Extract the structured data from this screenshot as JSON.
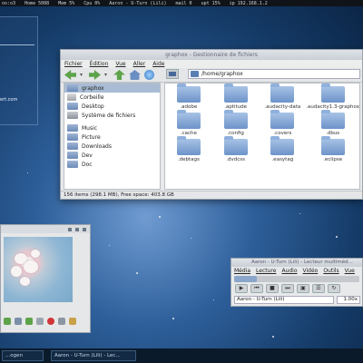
{
  "topbar": {
    "items": [
      "oo:o3",
      "Home 5088",
      "Mem 5%",
      "Cpu 0%",
      "Aaron - U-Turn (Lili)",
      "mail 0",
      "upt 15%",
      "ip 192.168.1.2"
    ]
  },
  "ghost": {
    "url": "ert.com"
  },
  "file_manager": {
    "title": "graphox - Gestionnaire de fichiers",
    "menu": [
      "Fichier",
      "Édition",
      "Vue",
      "Aller",
      "Aide"
    ],
    "path": "/home/graphox",
    "sidebar": [
      {
        "label": "graphox",
        "icon": "home-folder-icon",
        "active": true
      },
      {
        "label": "Corbeille",
        "icon": "trash-icon"
      },
      {
        "label": "Desktop",
        "icon": "folder-icon"
      },
      {
        "label": "Système de fichiers",
        "icon": "drive-icon"
      },
      {
        "label": "Music",
        "icon": "folder-icon"
      },
      {
        "label": "Picture",
        "icon": "folder-icon"
      },
      {
        "label": "Downloads",
        "icon": "folder-icon"
      },
      {
        "label": "Dev",
        "icon": "folder-icon"
      },
      {
        "label": "Doc",
        "icon": "folder-icon"
      }
    ],
    "files": [
      ".adobe",
      ".aptitude",
      ".audacity-data",
      ".audacity1.3-graphox",
      ".cache",
      ".config",
      ".covers",
      ".dbus",
      ".debtags",
      ".dvdcss",
      ".easytag",
      ".eclipse"
    ],
    "status": "156 items (298.1 MB), Free space: 403.8 GB"
  },
  "media_player": {
    "title": "Aaron - U-Turn (Lili) - Lecteur multiméd...",
    "menu": [
      "Média",
      "Lecture",
      "Audio",
      "Vidéo",
      "Outils",
      "Vue"
    ],
    "progress": 0.18,
    "track": "Aaron - U-Turn (Lili)",
    "speed": "1.00x"
  },
  "taskbar": {
    "items": [
      "...ogen",
      "Aaron - U-Turn (Lili) - Lec..."
    ]
  },
  "colors": {
    "accent": "#5a7fb5",
    "desktop": "#2e5f9a"
  }
}
